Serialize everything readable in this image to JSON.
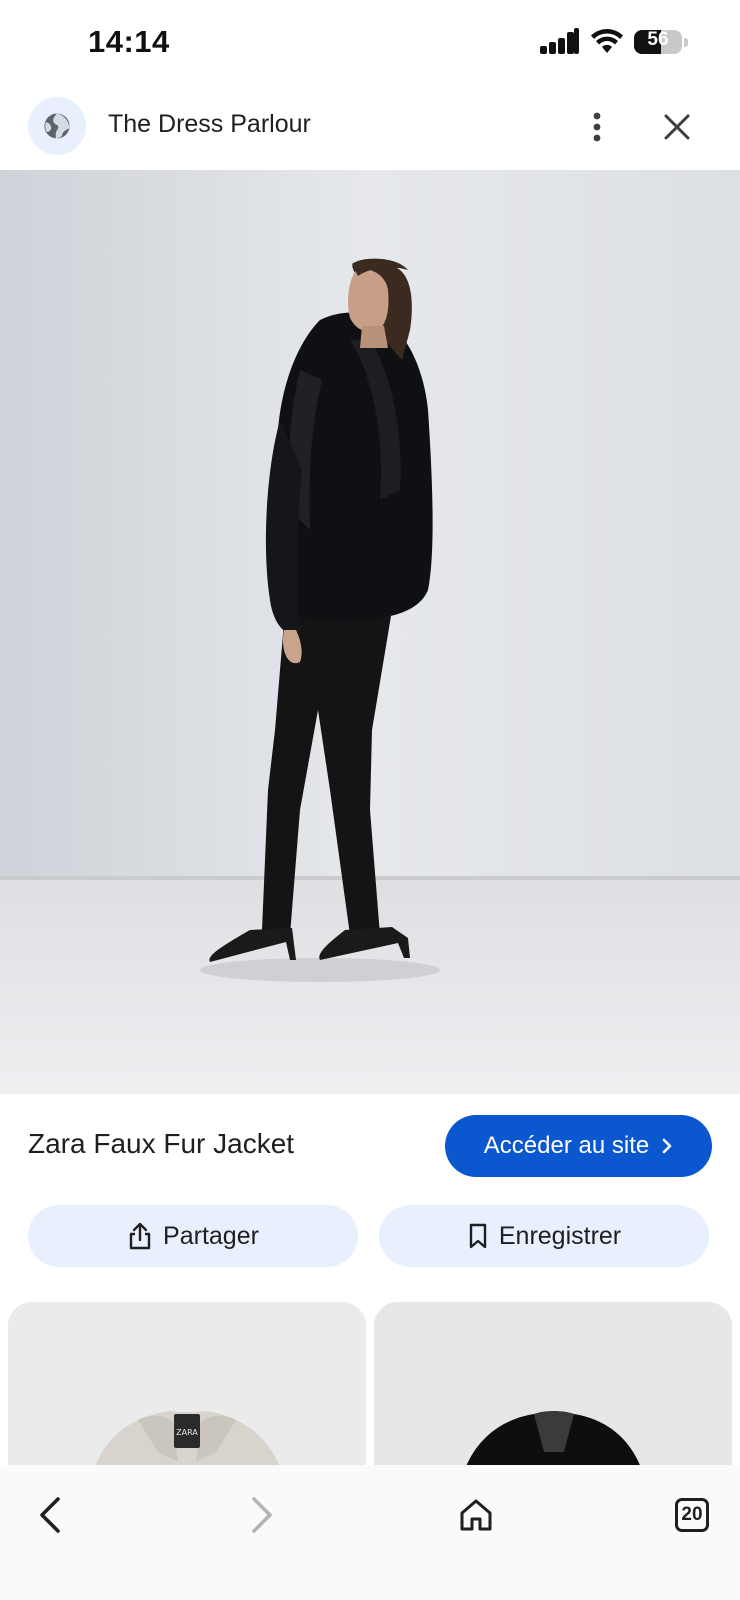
{
  "status_bar": {
    "time": "14:14",
    "battery_level": "56",
    "battery_fraction": 0.56,
    "icons": [
      "signal-icon",
      "wifi-icon",
      "battery-icon"
    ]
  },
  "header": {
    "site_name": "The Dress Parlour",
    "favicon_icon": "globe-icon",
    "more_icon": "more-vertical-icon",
    "close_icon": "close-icon"
  },
  "main_image": {
    "subject": "woman-in-black-faux-fur-jacket"
  },
  "product": {
    "title": "Zara Faux Fur Jacket",
    "visit_label": "Accéder au site",
    "visit_icon": "chevron-right-icon"
  },
  "actions": {
    "share_label": "Partager",
    "share_icon": "share-icon",
    "save_label": "Enregistrer",
    "save_icon": "bookmark-icon"
  },
  "related": {
    "card_1_subject": "grey-faux-fur-jacket",
    "card_1_tag": "ZARA",
    "card_2_subject": "black-faux-fur-jacket"
  },
  "bottom_nav": {
    "tab_count": "20",
    "icons": [
      "back-icon",
      "forward-icon",
      "home-icon",
      "tabs-icon"
    ]
  },
  "colors": {
    "accent": "#0b57d0",
    "tonal_button": "#e8f0fe",
    "text": "#1f1f1f"
  }
}
